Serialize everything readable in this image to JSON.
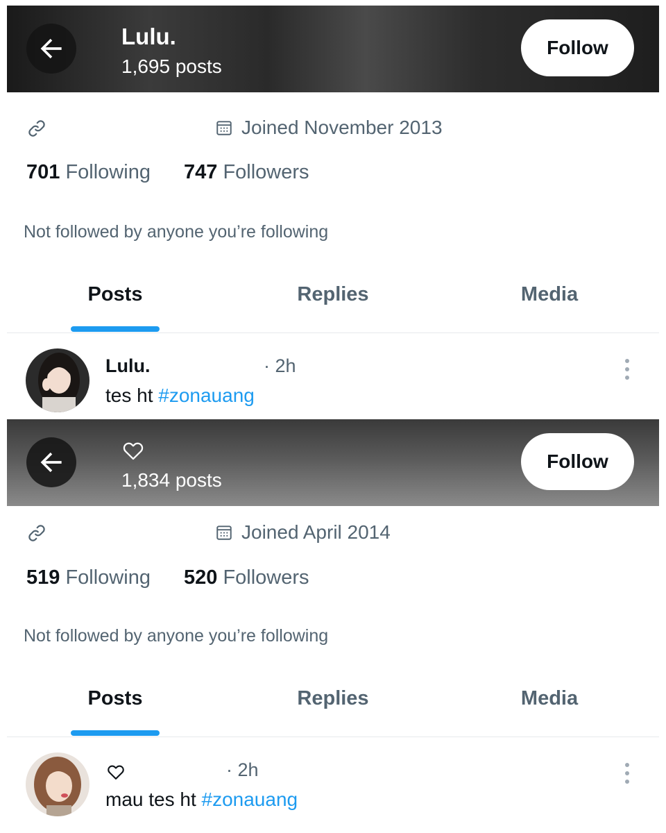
{
  "profiles": [
    {
      "header": {
        "name": "Lulu.",
        "posts": "1,695 posts",
        "follow_label": "Follow"
      },
      "joined": "Joined November 2013",
      "following_count": "701",
      "following_label": "Following",
      "followers_count": "747",
      "followers_label": "Followers",
      "not_followed": "Not followed by anyone you’re following",
      "tabs": [
        "Posts",
        "Replies",
        "Media"
      ],
      "post": {
        "author": "Lulu.",
        "time": "· 2h",
        "text": "tes ht ",
        "hashtag": "#zonauang"
      }
    },
    {
      "header": {
        "name_icon": "heart-outline-icon",
        "posts": "1,834 posts",
        "follow_label": "Follow"
      },
      "joined": "Joined April 2014",
      "following_count": "519",
      "following_label": "Following",
      "followers_count": "520",
      "followers_label": "Followers",
      "not_followed": "Not followed by anyone you’re following",
      "tabs": [
        "Posts",
        "Replies",
        "Media"
      ],
      "post": {
        "author_icon": "heart-outline-icon",
        "time": "· 2h",
        "text": "mau tes ht ",
        "hashtag": "#zonauang"
      }
    }
  ],
  "colors": {
    "accent": "#1d9bf0",
    "secondary_text": "#536471",
    "primary_text": "#0f1419"
  }
}
